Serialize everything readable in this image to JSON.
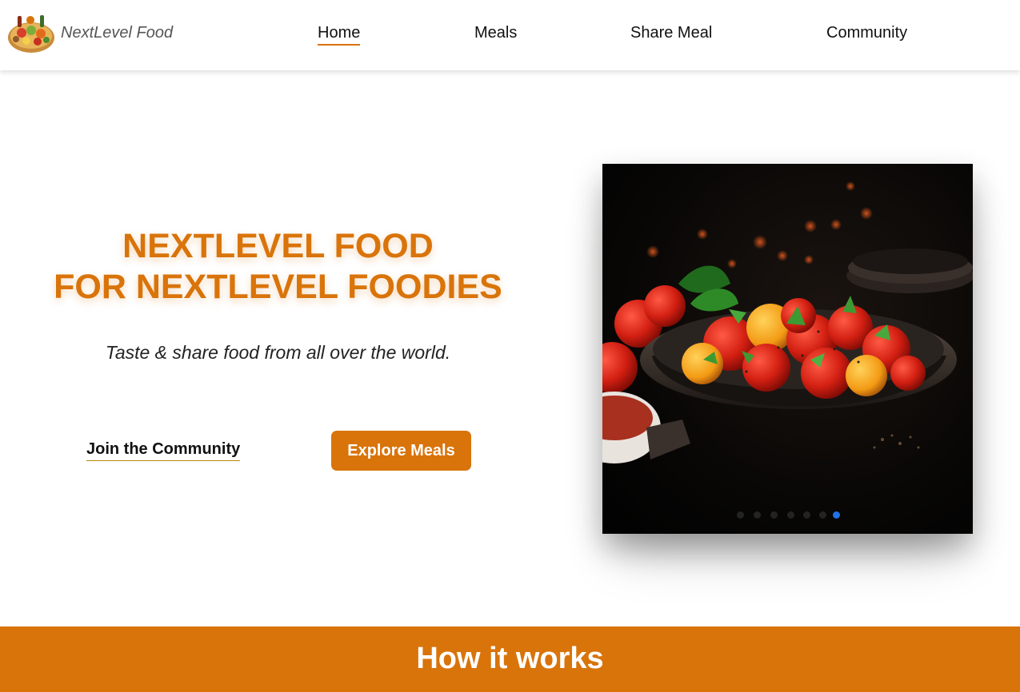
{
  "header": {
    "logo_text": "NextLevel Food",
    "nav": [
      {
        "label": "Home",
        "active": true
      },
      {
        "label": "Meals",
        "active": false
      },
      {
        "label": "Share Meal",
        "active": false
      },
      {
        "label": "Community",
        "active": false
      }
    ]
  },
  "hero": {
    "title_line1": "NEXTLEVEL FOOD",
    "title_line2": "FOR NEXTLEVEL FOODIES",
    "subtitle": "Taste & share food from all over the world.",
    "join_label": "Join the Community",
    "explore_label": "Explore Meals"
  },
  "slideshow": {
    "slide_count": 7,
    "active_index": 6
  },
  "how_it_works": {
    "title": "How it works"
  },
  "colors": {
    "accent": "#d9740a",
    "active_dot": "#1e73e8",
    "text": "#111111"
  }
}
